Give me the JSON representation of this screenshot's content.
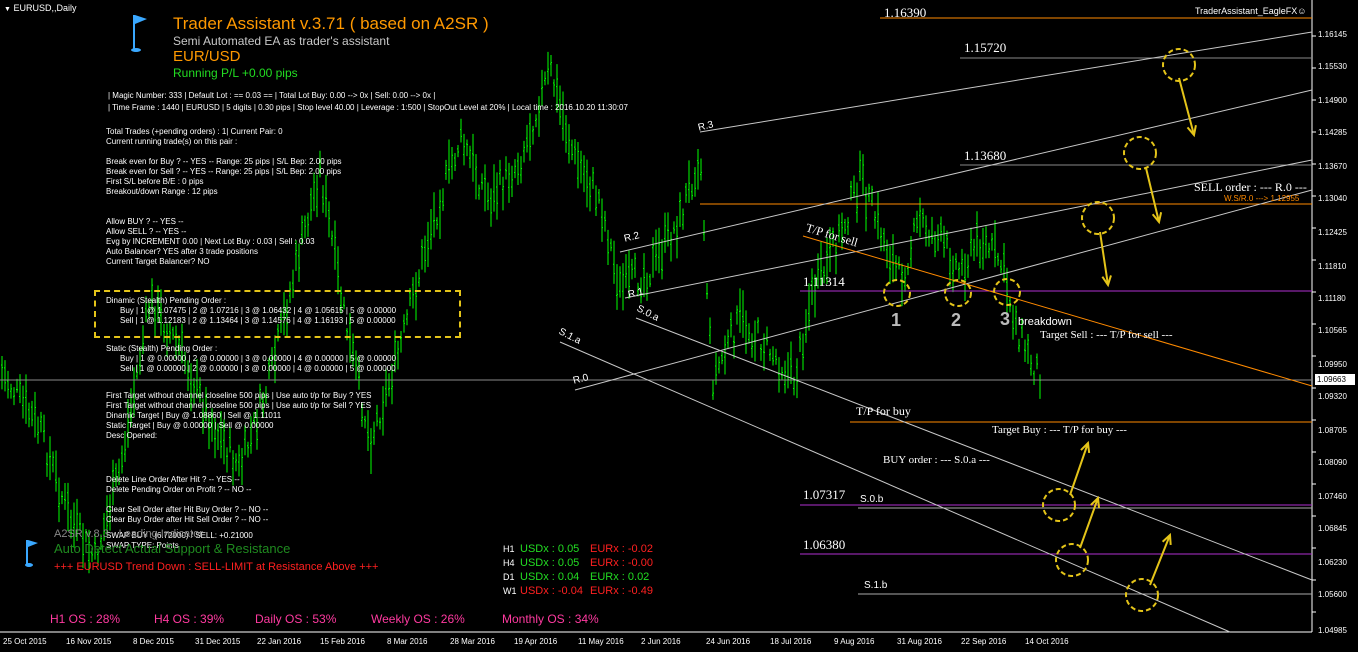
{
  "window": {
    "symbol_title": "EURUSD,,Daily",
    "brand": "TraderAssistant_EagleFX☺",
    "current_price": "1.09663"
  },
  "header": {
    "title": "Trader Assistant v.3.71 ( based on A2SR )",
    "subtitle": "Semi Automated EA as trader's assistant",
    "pair": "EUR/USD",
    "running_pl": "Running P/L +0.00 pips"
  },
  "info_lines": [
    "| Magic Number: 333 | Default Lot : == 0.03 == | Total Lot Buy: 0.00 --> 0x | Sell: 0.00 --> 0x |",
    "| Time Frame : 1440 | EURUSD | 5 digits | 0.30 pips | Stop level 40.00 | Leverage : 1:500 | StopOut Level at 20% | Local time : 2016.10.20 11:30:07"
  ],
  "status_panel": [
    "Total Trades (+pending orders) : 1| Current Pair: 0",
    "Current running trade(s) on this pair :",
    "",
    "Break even for Buy ? -- YES -- Range: 25 pips | S/L Bep: 2.00 pips",
    "Break even for Sell ? -- YES -- Range: 25 pips | S/L Bep: 2.00 pips",
    "First S/L before B/E : 0 pips",
    "Breakout/down Range : 12 pips",
    "",
    "Allow BUY ? -- YES --",
    "Allow SELL ? -- YES --",
    "Evg by INCREMENT 0.00 | Next Lot Buy : 0.03 | Sell : 0.03",
    "Auto Balancer? YES after 3 trade positions",
    "Current Target Balancer? NO"
  ],
  "dinamic_panel": [
    "Dinamic (Stealth) Pending Order :",
    "Buy    | 1 @ 1.07475  | 2 @ 1.07216  | 3 @ 1.06432  | 4 @ 1.05615  | 5 @ 0.00000",
    "Sell    | 1 @ 1.12183  | 2 @ 1.13464  | 3 @ 1.14576  | 4 @ 1.16193  | 5 @ 0.00000"
  ],
  "static_panel": [
    "Static (Stealth) Pending Order :",
    "Buy    | 1 @ 0.00000  | 2 @ 0.00000  | 3 @ 0.00000  | 4 @ 0.00000  | 5 @ 0.00000",
    "Sell    | 1 @ 0.00000  | 2 @ 0.00000  | 3 @ 0.00000  | 4 @ 0.00000  | 5 @ 0.00000"
  ],
  "target_panel": [
    "First Target without channel closeline 500 pips | Use auto t/p for Buy ? YES",
    "First Target without channel closeline 500 pips | Use auto t/p for Sell ? YES",
    "Dinamic Target  | Buy @ 1.08860 | Sell @ 1.11011",
    "Static Target    | Buy @ 0.00000 | Sell @ 0.00000",
    "Desc Opened:"
  ],
  "misc_panel": [
    "Delete Line Order After Hit ? -- YES --",
    "Delete Pending Order on Profit ? -- NO --",
    "",
    "Clear Sell Order after Hit Buy Order ? -- NO --",
    "Clear Buy Order after Hit Sell Order ? -- NO --",
    "",
    "SWAP BUY : (6.72000) / SELL: +0.21000",
    "SWAP TYPE: Points"
  ],
  "a2sr": {
    "line1": "A2SR v.8.3 - Leading Indicator",
    "line2": "Auto Detect Actual Support & Resistance",
    "line3": "+++ EURUSD Trend Down : SELL-LIMIT at Resistance Above +++"
  },
  "currency_strength": [
    {
      "tf": "H1",
      "usd": "USDx : 0.05",
      "eur": "EURx : -0.02"
    },
    {
      "tf": "H4",
      "usd": "USDx : 0.05",
      "eur": "EURx : -0.00"
    },
    {
      "tf": "D1",
      "usd": "USDx : 0.04",
      "eur": "EURx : 0.02"
    },
    {
      "tf": "W1",
      "usd": "USDx : -0.04",
      "eur": "EURx : -0.49"
    }
  ],
  "os_bar": [
    "H1 OS : 28%",
    "H4 OS : 39%",
    "Daily OS : 53%",
    "Weekly OS : 26%",
    "Monthly OS : 34%"
  ],
  "y_axis": [
    "1.16145",
    "1.15530",
    "1.14900",
    "1.14285",
    "1.13670",
    "1.13040",
    "1.12425",
    "1.11810",
    "1.11180",
    "1.10565",
    "1.09950",
    "1.09320",
    "1.08705",
    "1.08090",
    "1.07460",
    "1.06845",
    "1.06230",
    "1.05600",
    "1.04985"
  ],
  "x_axis": [
    "25 Oct 2015",
    "16 Nov 2015",
    "8 Dec 2015",
    "31 Dec 2015",
    "22 Jan 2016",
    "15 Feb 2016",
    "8 Mar 2016",
    "28 Mar 2016",
    "19 Apr 2016",
    "11 May 2016",
    "2 Jun 2016",
    "24 Jun 2016",
    "18 Jul 2016",
    "9 Aug 2016",
    "31 Aug 2016",
    "22 Sep 2016",
    "14 Oct 2016"
  ],
  "levels": {
    "l1": "1.16390",
    "l2": "1.15720",
    "l3": "1.13680",
    "l4": "1.11314",
    "l5": "1.07317",
    "l6": "1.06380"
  },
  "chart_labels": {
    "r3": "R.3",
    "r2": "R.2",
    "r1": "R.1",
    "r0": "R.0",
    "s0a": "S.0.a",
    "s1a": "S.1.a",
    "s0b": "S.0.b",
    "s1b": "S.1.b",
    "tp_sell": "T/P for sell",
    "tp_buy": "T/P for buy",
    "sell_order": "SELL order : --- R.0 ---",
    "ws": "W.S/R.0 ---> 1.12955",
    "target_sell": "Target Sell : --- T/P for sell ---",
    "target_buy": "Target Buy : --- T/P for buy ---",
    "buy_order": "BUY order : --- S.0.a ---",
    "breakdown": "breakdown",
    "n1": "1",
    "n2": "2",
    "n3": "3"
  },
  "colors": {
    "candles": "#00ff00",
    "title": "#ff9900",
    "pl": "#22dd22",
    "channel": "#c8c8c8",
    "level_violet": "#b030d0",
    "level_orange": "#ff8a00",
    "dashed": "#e4c419",
    "os": "#ff3aa0",
    "red": "#ff2020"
  }
}
